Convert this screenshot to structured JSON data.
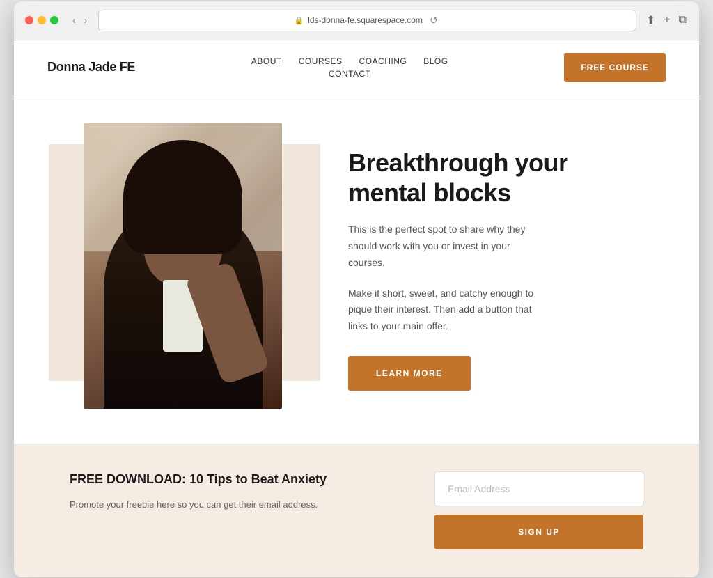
{
  "browser": {
    "url": "lds-donna-fe.squarespace.com",
    "reload_label": "↺",
    "back_label": "‹",
    "forward_label": "›"
  },
  "site": {
    "logo": "Donna Jade FE",
    "nav": {
      "items": [
        {
          "label": "ABOUT",
          "id": "about"
        },
        {
          "label": "COURSES",
          "id": "courses"
        },
        {
          "label": "COACHING",
          "id": "coaching"
        },
        {
          "label": "BLOG",
          "id": "blog"
        },
        {
          "label": "CONTACT",
          "id": "contact"
        }
      ],
      "cta_label": "FREE COURSE"
    },
    "hero": {
      "headline": "Breakthrough your mental blocks",
      "body1": "This is the perfect spot to share why they should work with you or invest in your courses.",
      "body2": "Make it short, sweet, and catchy enough to pique their interest. Then add a button that links to your main offer.",
      "cta_label": "LEARN MORE"
    },
    "signup": {
      "title": "FREE DOWNLOAD: 10 Tips to Beat Anxiety",
      "description": "Promote your freebie here so you can get their email address.",
      "email_placeholder": "Email Address",
      "button_label": "SIGN UP"
    }
  }
}
